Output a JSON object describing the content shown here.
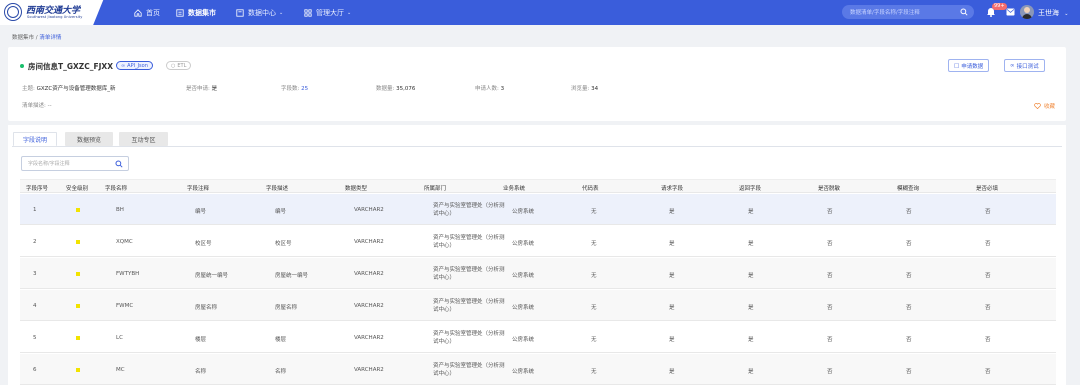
{
  "header": {
    "logo_title": "西南交通大学",
    "logo_subtitle": "Southwest Jiaotong University",
    "nav": [
      {
        "label": "首页",
        "icon": "home-icon"
      },
      {
        "label": "数据集市",
        "icon": "dataset-icon"
      },
      {
        "label": "数据中心",
        "icon": "data-center-icon"
      },
      {
        "label": "管理大厅",
        "icon": "grid-icon"
      }
    ],
    "search_placeholder": "数据清单/字段名称/字段注释",
    "notification_badge": "99+",
    "username": "王世海"
  },
  "breadcrumb": {
    "root": "数据集市",
    "separator": "/",
    "current": "清单详情"
  },
  "detail": {
    "title": "房间信息T_GXZC_FJXX",
    "tag_api": "API_Json",
    "tag_etl": "ETL",
    "apply_button": "申请数据",
    "test_button": "接口测试",
    "meta": {
      "theme_label": "主题:",
      "theme_value": "GXZC资产与设备管理数据库_新",
      "need_apply_label": "是否申请:",
      "need_apply_value": "是",
      "field_count_label": "字段数:",
      "field_count_value": "25",
      "data_count_label": "数据量:",
      "data_count_value": "35,076",
      "applicants_label": "申请人数:",
      "applicants_value": "3",
      "views_label": "浏览量:",
      "views_value": "34"
    },
    "desc_label": "清单描述:",
    "desc_value": "--",
    "favorite": "收藏"
  },
  "tabs": [
    "字段说明",
    "数据预览",
    "互动专区"
  ],
  "field_search_placeholder": "字段名称/字段注释",
  "table": {
    "columns": [
      "字段序号",
      "安全级别",
      "字段名称",
      "字段注释",
      "字段描述",
      "数据类型",
      "所属部门",
      "业务系统",
      "代码表",
      "请求字段",
      "返回字段",
      "是否脱敏",
      "模糊查询",
      "是否必填"
    ],
    "rows": [
      {
        "no": "1",
        "name": "BH",
        "comment": "编号",
        "desc": "编号",
        "type": "VARCHAR2",
        "dept": "资产与实验室管理处（分析测试中心）",
        "system": "公房系统",
        "code": "无",
        "req": "是",
        "ret": "是",
        "mask": "否",
        "fuzzy": "否",
        "required": "否"
      },
      {
        "no": "2",
        "name": "XQMC",
        "comment": "校区号",
        "desc": "校区号",
        "type": "VARCHAR2",
        "dept": "资产与实验室管理处（分析测试中心）",
        "system": "公房系统",
        "code": "无",
        "req": "是",
        "ret": "是",
        "mask": "否",
        "fuzzy": "否",
        "required": "否"
      },
      {
        "no": "3",
        "name": "FWTYBH",
        "comment": "房屋统一编号",
        "desc": "房屋统一编号",
        "type": "VARCHAR2",
        "dept": "资产与实验室管理处（分析测试中心）",
        "system": "公房系统",
        "code": "无",
        "req": "是",
        "ret": "是",
        "mask": "否",
        "fuzzy": "否",
        "required": "否"
      },
      {
        "no": "4",
        "name": "FWMC",
        "comment": "房屋名称",
        "desc": "房屋名称",
        "type": "VARCHAR2",
        "dept": "资产与实验室管理处（分析测试中心）",
        "system": "公房系统",
        "code": "无",
        "req": "是",
        "ret": "是",
        "mask": "否",
        "fuzzy": "否",
        "required": "否"
      },
      {
        "no": "5",
        "name": "LC",
        "comment": "楼层",
        "desc": "楼层",
        "type": "VARCHAR2",
        "dept": "资产与实验室管理处（分析测试中心）",
        "system": "公房系统",
        "code": "无",
        "req": "是",
        "ret": "是",
        "mask": "否",
        "fuzzy": "否",
        "required": "否"
      },
      {
        "no": "6",
        "name": "MC",
        "comment": "名称",
        "desc": "名称",
        "type": "VARCHAR2",
        "dept": "资产与实验室管理处（分析测试中心）",
        "system": "公房系统",
        "code": "无",
        "req": "是",
        "ret": "是",
        "mask": "否",
        "fuzzy": "否",
        "required": "否"
      }
    ]
  },
  "colors": {
    "primary": "#3a5ddb",
    "security_level": "#f2e300",
    "online_dot": "#19be6b",
    "favorite": "#f0883a"
  }
}
